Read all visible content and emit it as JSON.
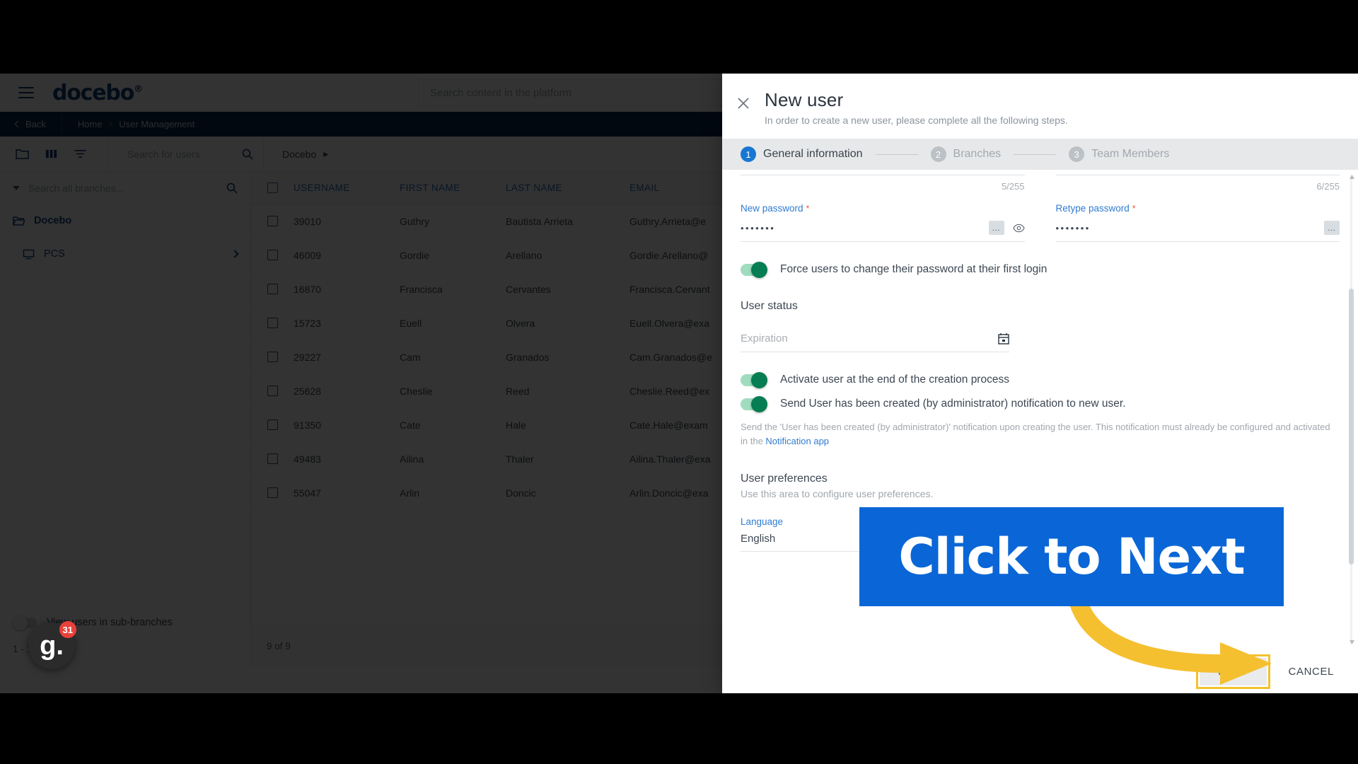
{
  "app": {
    "brand": "docebo",
    "brand_mark": "®",
    "global_search_placeholder": "Search content in the platform",
    "breadcrumb": {
      "back": "Back",
      "items": [
        "Home",
        "User Management"
      ],
      "separator": "›"
    },
    "toolbar": {
      "search_placeholder": "Search for users",
      "branch_crumb": "Docebo",
      "branch_crumb_arrow": "▸"
    },
    "branch_panel": {
      "search_placeholder": "Search all branches...",
      "items": [
        {
          "label": "Docebo",
          "icon": "folder-icon",
          "expandable": false
        },
        {
          "label": "PCS",
          "icon": "monitor-icon",
          "expandable": true
        }
      ],
      "sub_branch_toggle_label": "View users in sub-branches",
      "footer": "1 - 1 of 1"
    },
    "table": {
      "columns": [
        "USERNAME",
        "FIRST NAME",
        "LAST NAME",
        "EMAIL"
      ],
      "rows": [
        {
          "username": "39010",
          "first": "Guthry",
          "last": "Bautista Arrieta",
          "email": "Guthry.Arrieta@e"
        },
        {
          "username": "46009",
          "first": "Gordie",
          "last": "Arellano",
          "email": "Gordie.Arellano@"
        },
        {
          "username": "16870",
          "first": "Francisca",
          "last": "Cervantes",
          "email": "Francisca.Cervant"
        },
        {
          "username": "15723",
          "first": "Euell",
          "last": "Olvera",
          "email": "Euell.Olvera@exa"
        },
        {
          "username": "29227",
          "first": "Cam",
          "last": "Granados",
          "email": "Cam.Granados@e"
        },
        {
          "username": "25628",
          "first": "Cheslie",
          "last": "Reed",
          "email": "Cheslie.Reed@ex"
        },
        {
          "username": "91350",
          "first": "Cate",
          "last": "Hale",
          "email": "Cate.Hale@exam"
        },
        {
          "username": "49483",
          "first": "Ailina",
          "last": "Thaler",
          "email": "Ailina.Thaler@exa"
        },
        {
          "username": "55047",
          "first": "Arlin",
          "last": "Doncic",
          "email": "Arlin.Doncic@exa"
        }
      ],
      "footer_count": "9 of 9"
    },
    "guide_badge": {
      "letter": "g.",
      "count": "31"
    }
  },
  "modal": {
    "title": "New user",
    "subtitle": "In order to create a new user, please complete all the following steps.",
    "close_label": "×",
    "steps": [
      {
        "num": "1",
        "label": "General information",
        "active": true
      },
      {
        "num": "2",
        "label": "Branches",
        "active": false
      },
      {
        "num": "3",
        "label": "Team Members",
        "active": false
      }
    ],
    "fields": {
      "left_counter": "5/255",
      "right_counter": "6/255",
      "new_password_label": "New password",
      "new_password_value": "•••••••",
      "retype_password_label": "Retype password",
      "retype_password_value": "•••••••",
      "required_mark": "*",
      "generate_icon": "generate-password-icon",
      "eye_icon": "show-password-icon"
    },
    "force_change_toggle": {
      "label": "Force users to change their password at their first login",
      "on": true
    },
    "user_status": {
      "title": "User status",
      "expiration_placeholder": "Expiration",
      "calendar_icon": "calendar-icon"
    },
    "activate_toggle": {
      "label": "Activate user at the end of the creation process",
      "on": true
    },
    "notify_toggle": {
      "label": "Send User has been created (by administrator) notification to new user.",
      "on": true
    },
    "notify_helper_pre": "Send the 'User has been created (by administrator)' notification upon creating the user. This notification must already be configured and activated in the ",
    "notify_helper_link": "Notification app",
    "user_preferences": {
      "title": "User preferences",
      "subtitle": "Use this area to configure user preferences.",
      "language_label": "Language",
      "language_value": "English"
    },
    "footer": {
      "next": "NEXT",
      "cancel": "CANCEL"
    }
  },
  "cta": {
    "text": "Click to Next",
    "bg_color": "#0a66d6",
    "arrow_color": "#f5c030",
    "highlight_color": "#f2c12e"
  }
}
